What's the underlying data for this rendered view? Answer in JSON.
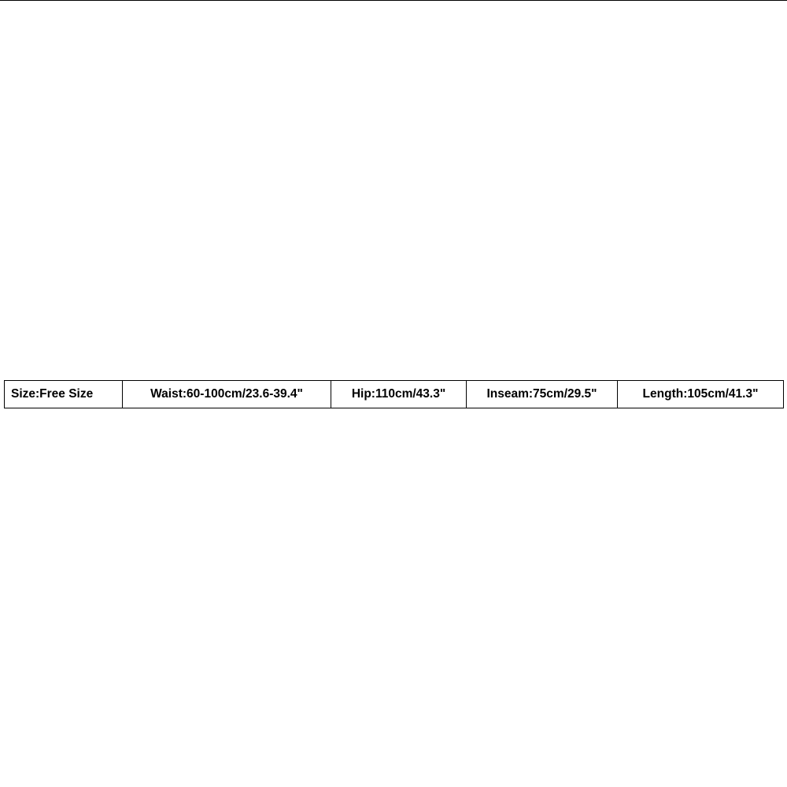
{
  "row": {
    "size": "Size:Free Size",
    "waist": "Waist:60-100cm/23.6-39.4\"",
    "hip": "Hip:110cm/43.3\"",
    "inseam": "Inseam:75cm/29.5\"",
    "length": "Length:105cm/41.3\""
  }
}
